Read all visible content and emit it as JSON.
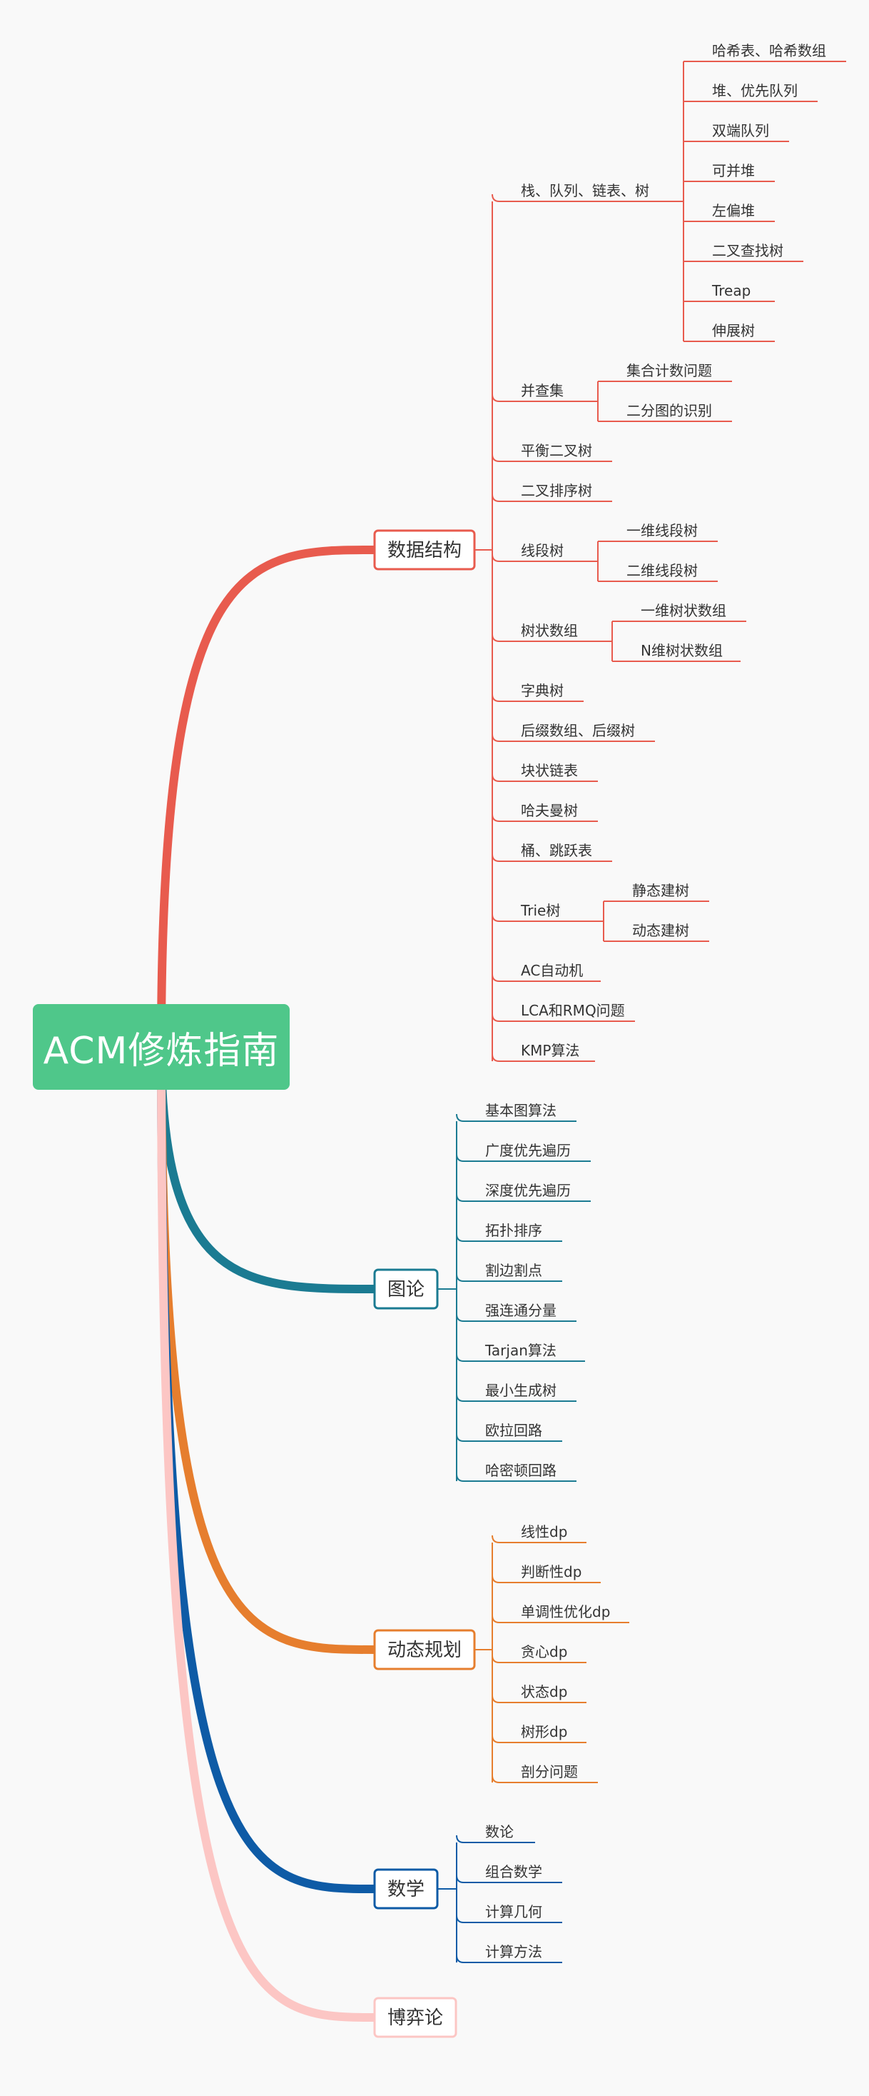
{
  "root": {
    "label": "ACM修炼指南",
    "color": "#4fc78a"
  },
  "branches": [
    {
      "label": "数据结构",
      "color": "#e85b4e",
      "children": [
        {
          "label": "栈、队列、链表、树",
          "children": [
            "哈希表、哈希数组",
            "堆、优先队列",
            "双端队列",
            "可并堆",
            "左偏堆",
            "二叉查找树",
            "Treap",
            "伸展树"
          ]
        },
        {
          "label": "并查集",
          "children": [
            "集合计数问题",
            "二分图的识别"
          ]
        },
        {
          "label": "平衡二叉树"
        },
        {
          "label": "二叉排序树"
        },
        {
          "label": "线段树",
          "children": [
            "一维线段树",
            "二维线段树"
          ]
        },
        {
          "label": "树状数组",
          "children": [
            "一维树状数组",
            "N维树状数组"
          ]
        },
        {
          "label": "字典树"
        },
        {
          "label": "后缀数组、后缀树"
        },
        {
          "label": "块状链表"
        },
        {
          "label": "哈夫曼树"
        },
        {
          "label": "桶、跳跃表"
        },
        {
          "label": "Trie树",
          "children": [
            "静态建树",
            "动态建树"
          ]
        },
        {
          "label": "AC自动机"
        },
        {
          "label": "LCA和RMQ问题"
        },
        {
          "label": "KMP算法"
        }
      ]
    },
    {
      "label": "图论",
      "color": "#1b7b92",
      "children": [
        {
          "label": "基本图算法"
        },
        {
          "label": "广度优先遍历"
        },
        {
          "label": "深度优先遍历"
        },
        {
          "label": "拓扑排序"
        },
        {
          "label": "割边割点"
        },
        {
          "label": "强连通分量"
        },
        {
          "label": "Tarjan算法"
        },
        {
          "label": "最小生成树"
        },
        {
          "label": "欧拉回路"
        },
        {
          "label": "哈密顿回路"
        }
      ]
    },
    {
      "label": "动态规划",
      "color": "#e67e2e",
      "children": [
        {
          "label": "线性dp"
        },
        {
          "label": "判断性dp"
        },
        {
          "label": "单调性优化dp"
        },
        {
          "label": "贪心dp"
        },
        {
          "label": "状态dp"
        },
        {
          "label": "树形dp"
        },
        {
          "label": "剖分问题"
        }
      ]
    },
    {
      "label": "数学",
      "color": "#0e5ba6",
      "children": [
        {
          "label": "数论"
        },
        {
          "label": "组合数学"
        },
        {
          "label": "计算几何"
        },
        {
          "label": "计算方法"
        }
      ]
    },
    {
      "label": "博弈论",
      "color": "#fcc6c4",
      "children": []
    }
  ]
}
